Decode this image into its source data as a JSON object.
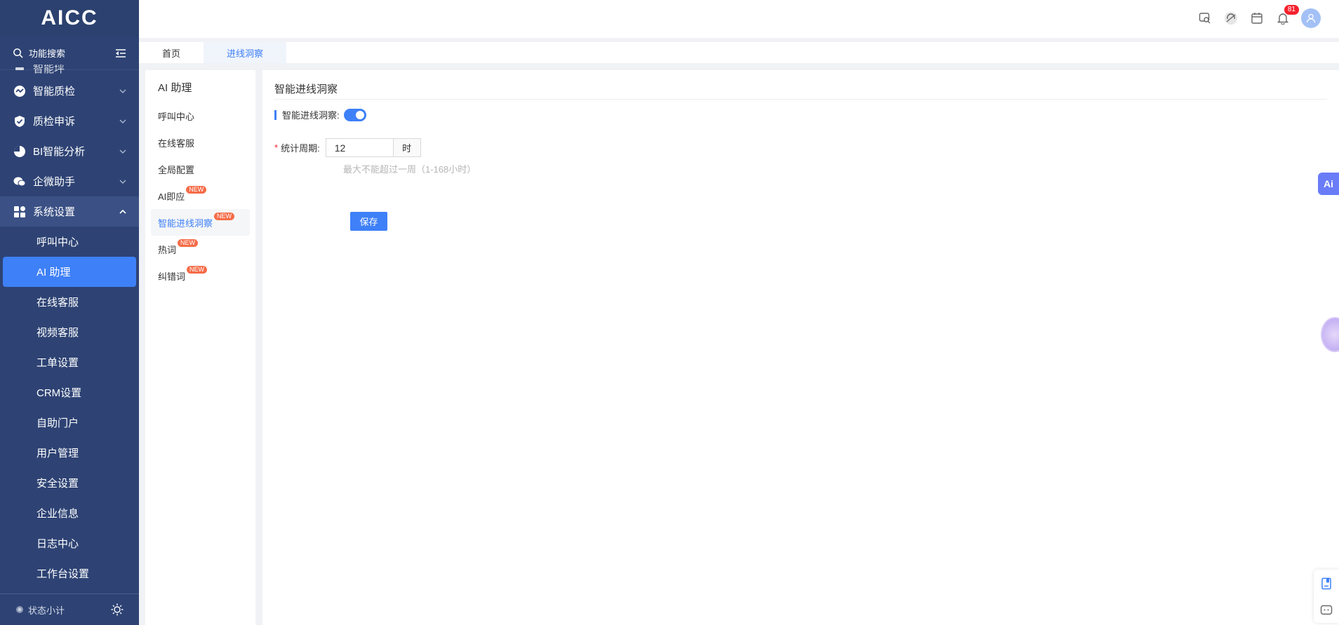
{
  "sidebar": {
    "logo": "AICC",
    "search_label": "功能搜索",
    "partial_item": "智能坪",
    "items": [
      {
        "label": "智能质检"
      },
      {
        "label": "质检申诉"
      },
      {
        "label": "BI智能分析"
      },
      {
        "label": "企微助手"
      },
      {
        "label": "系统设置"
      }
    ],
    "sub_items": [
      {
        "label": "呼叫中心"
      },
      {
        "label": "AI 助理"
      },
      {
        "label": "在线客服"
      },
      {
        "label": "视频客服"
      },
      {
        "label": "工单设置"
      },
      {
        "label": "CRM设置"
      },
      {
        "label": "自助门户"
      },
      {
        "label": "用户管理"
      },
      {
        "label": "安全设置"
      },
      {
        "label": "企业信息"
      },
      {
        "label": "日志中心"
      },
      {
        "label": "工作台设置"
      }
    ],
    "footer_status": "状态小计"
  },
  "header": {
    "notification_count": "81"
  },
  "tabs": [
    {
      "label": "首页"
    },
    {
      "label": "进线洞察"
    }
  ],
  "submenu": {
    "title": "AI 助理",
    "items": [
      {
        "label": "呼叫中心"
      },
      {
        "label": "在线客服"
      },
      {
        "label": "全局配置"
      },
      {
        "label": "AI即应",
        "tag": "NEW"
      },
      {
        "label": "智能进线洞察",
        "tag": "NEW"
      },
      {
        "label": "热词",
        "tag": "NEW"
      },
      {
        "label": "纠错词",
        "tag": "NEW"
      }
    ]
  },
  "main": {
    "title": "智能进线洞察",
    "switch_label": "智能进线洞察:",
    "period_label": "统计周期:",
    "period_value": "12",
    "period_unit": "时",
    "hint": "最大不能超过一周（1-168小时）",
    "save_label": "保存"
  },
  "floating": {
    "ai_label": "Ai"
  }
}
